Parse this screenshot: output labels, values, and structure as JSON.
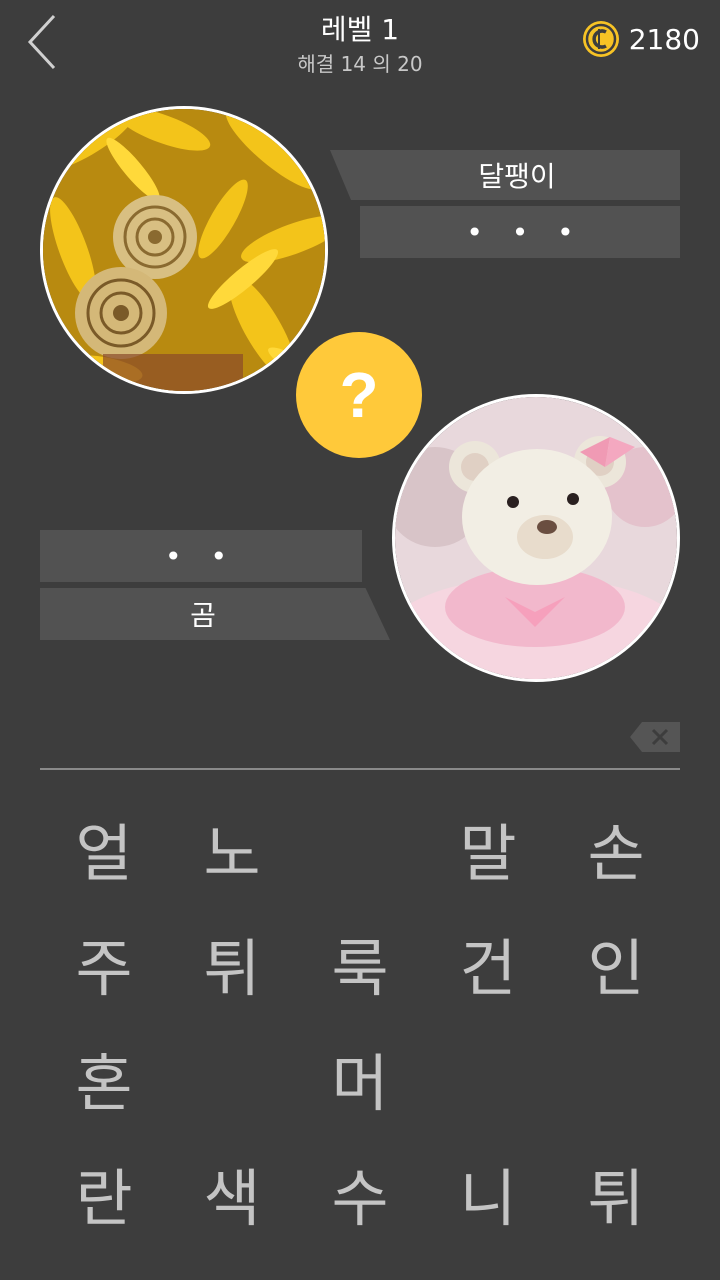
{
  "header": {
    "title": "레벨 1",
    "subtitle": "해결 14 의 20",
    "coins": "2180"
  },
  "words": {
    "top_answer": "달팽이",
    "top_hint": "• • •",
    "bottom_hint": "• •",
    "bottom_answer": "곰"
  },
  "question_mark": "?",
  "letters": [
    [
      "얼",
      "노",
      "",
      "말",
      "손"
    ],
    [
      "주",
      "튀",
      "룩",
      "건",
      "인"
    ],
    [
      "혼",
      "",
      "머",
      "",
      ""
    ],
    [
      "란",
      "색",
      "수",
      "니",
      "튀"
    ]
  ],
  "colors": {
    "background": "#3d3d3d",
    "bar": "#525252",
    "accent_yellow": "#ffc93a",
    "letter": "#c4c4c4"
  },
  "images": {
    "first": "yellow flowers with two snail shells",
    "second": "white teddy bear in pink tutu"
  }
}
